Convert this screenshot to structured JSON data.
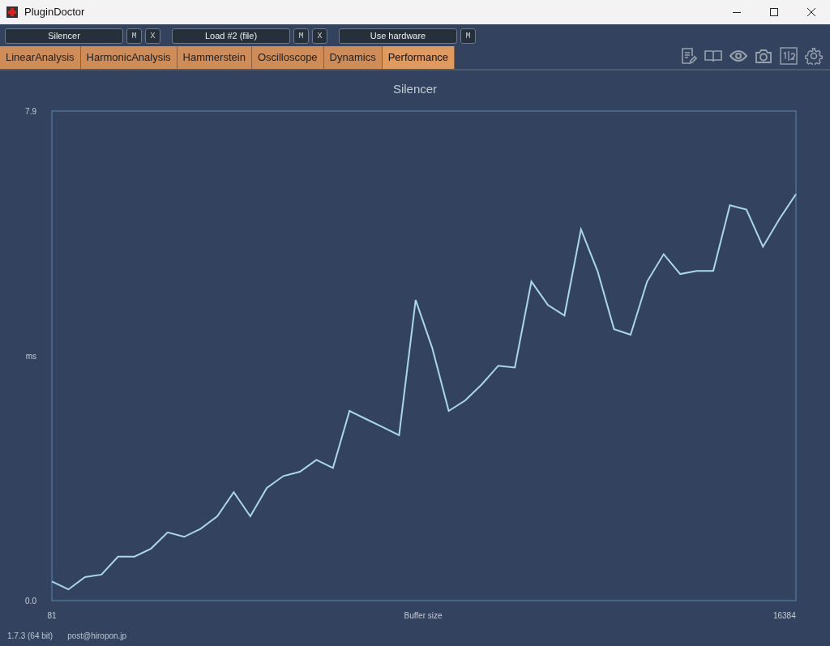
{
  "window": {
    "title": "PluginDoctor"
  },
  "toolbar": {
    "slots": [
      {
        "label": "Silencer",
        "buttons": [
          "M",
          "X"
        ]
      },
      {
        "label": "Load #2 (file)",
        "buttons": [
          "M",
          "X"
        ]
      },
      {
        "label": "Use hardware",
        "buttons": [
          "M"
        ]
      }
    ]
  },
  "tabs": [
    {
      "label": "LinearAnalysis",
      "selected": false
    },
    {
      "label": "HarmonicAnalysis",
      "selected": false
    },
    {
      "label": "Hammerstein",
      "selected": false
    },
    {
      "label": "Oscilloscope",
      "selected": false
    },
    {
      "label": "Dynamics",
      "selected": false
    },
    {
      "label": "Performance",
      "selected": true
    }
  ],
  "chart_panel": {
    "chart_data": {
      "type": "line",
      "title": "Silencer",
      "xlabel": "Buffer size",
      "ylabel": "ms",
      "x": [
        81,
        449,
        817,
        1185,
        1553,
        1921,
        2289,
        2657,
        3025,
        3393,
        3761,
        4129,
        4497,
        4865,
        5233,
        5601,
        5969,
        6337,
        6705,
        7073,
        7441,
        7809,
        8177,
        8545,
        8913,
        9281,
        9649,
        10017,
        10385,
        10753,
        11121,
        11489,
        11857,
        12225,
        12593,
        12961,
        13329,
        13697,
        14065,
        14433,
        14801,
        15169,
        15537,
        15905,
        16273,
        16640
      ],
      "series": [
        {
          "color": "#a9d8ea",
          "values": [
            0.31,
            0.18,
            0.38,
            0.42,
            0.71,
            0.71,
            0.84,
            1.1,
            1.03,
            1.16,
            1.36,
            1.75,
            1.36,
            1.82,
            2.01,
            2.08,
            2.27,
            2.14,
            3.06,
            2.93,
            2.8,
            2.67,
            4.85,
            4.08,
            3.06,
            3.23,
            3.49,
            3.79,
            3.76,
            5.15,
            4.77,
            4.6,
            5.99,
            5.32,
            4.38,
            4.29,
            5.15,
            5.59,
            5.27,
            5.32,
            5.32,
            6.38,
            6.31,
            5.71,
            6.16,
            6.56
          ]
        }
      ],
      "xlim": [
        81,
        16640
      ],
      "ylim": [
        0,
        7.9
      ],
      "xticks": [
        {
          "value": 81,
          "label": "81"
        },
        {
          "value": 16384,
          "label": "16384"
        }
      ],
      "yticks": [
        {
          "value": 0,
          "label": "0.0"
        },
        {
          "value": 7.9,
          "label": "7.9"
        }
      ]
    }
  },
  "status_bar": {
    "version": "1.7.3 (64 bit)",
    "contact": "post@hiropon.jp"
  }
}
